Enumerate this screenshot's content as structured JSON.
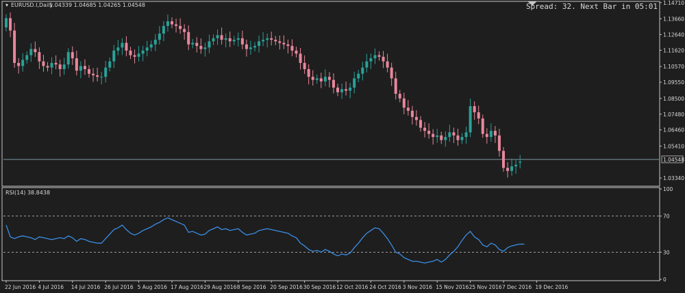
{
  "header": {
    "symbol": "EURUSD.I,Daily",
    "ohlc": "1.04339 1.04685 1.04265 1.04548",
    "spread_text": "Spread: 32. Next Bar in 05:01"
  },
  "colors": {
    "background": "#1e1e1e",
    "bull": "#2aa198",
    "bear": "#e8879c",
    "rsi_line": "#3a8ee6",
    "grid": "#c8c8c8",
    "current_price_line": "#7f9aa8"
  },
  "chart_data": [
    {
      "type": "candlestick",
      "title": "EURUSD.I,Daily",
      "ylim": [
        1.029,
        1.147
      ],
      "y_ticks": [
        "1.14710",
        "1.13660",
        "1.12640",
        "1.11620",
        "1.10570",
        "1.09550",
        "1.08500",
        "1.07480",
        "1.06460",
        "1.05410",
        "1.03340"
      ],
      "current_price": "1.04548",
      "x_labels": [
        "22 Jun 2016",
        "4 Jul 2016",
        "14 Jul 2016",
        "26 Jul 2016",
        "5 Aug 2016",
        "17 Aug 2016",
        "29 Aug 2016",
        "8 Sep 2016",
        "20 Sep 2016",
        "30 Sep 2016",
        "12 Oct 2016",
        "24 Oct 2016",
        "3 Nov 2016",
        "15 Nov 2016",
        "25 Nov 2016",
        "7 Dec 2016",
        "19 Dec 2016"
      ],
      "x_label_index": [
        0,
        8,
        16,
        24,
        32,
        40,
        48,
        56,
        64,
        72,
        80,
        88,
        96,
        104,
        112,
        120,
        128
      ],
      "close": [
        1.137,
        1.129,
        1.108,
        1.106,
        1.11,
        1.113,
        1.117,
        1.115,
        1.109,
        1.106,
        1.105,
        1.108,
        1.107,
        1.104,
        1.107,
        1.115,
        1.111,
        1.103,
        1.106,
        1.104,
        1.101,
        1.1,
        1.099,
        1.099,
        1.105,
        1.109,
        1.116,
        1.118,
        1.121,
        1.116,
        1.113,
        1.112,
        1.114,
        1.116,
        1.118,
        1.12,
        1.123,
        1.127,
        1.132,
        1.135,
        1.133,
        1.132,
        1.13,
        1.128,
        1.12,
        1.121,
        1.119,
        1.117,
        1.118,
        1.122,
        1.124,
        1.126,
        1.123,
        1.124,
        1.122,
        1.123,
        1.124,
        1.12,
        1.117,
        1.118,
        1.119,
        1.122,
        1.123,
        1.124,
        1.123,
        1.122,
        1.121,
        1.12,
        1.119,
        1.116,
        1.114,
        1.108,
        1.104,
        1.099,
        1.097,
        1.098,
        1.096,
        1.099,
        1.097,
        1.092,
        1.089,
        1.091,
        1.09,
        1.092,
        1.098,
        1.101,
        1.105,
        1.109,
        1.111,
        1.113,
        1.112,
        1.109,
        1.105,
        1.098,
        1.088,
        1.085,
        1.079,
        1.077,
        1.073,
        1.071,
        1.066,
        1.064,
        1.062,
        1.06,
        1.061,
        1.058,
        1.06,
        1.063,
        1.061,
        1.058,
        1.06,
        1.063,
        1.08,
        1.076,
        1.072,
        1.062,
        1.06,
        1.064,
        1.061,
        1.051,
        1.04,
        1.038,
        1.041,
        1.042,
        1.044,
        1.0455
      ],
      "open": [
        1.131,
        1.137,
        1.129,
        1.108,
        1.106,
        1.11,
        1.113,
        1.117,
        1.115,
        1.109,
        1.106,
        1.105,
        1.108,
        1.107,
        1.104,
        1.107,
        1.115,
        1.111,
        1.103,
        1.106,
        1.104,
        1.101,
        1.1,
        1.099,
        1.099,
        1.105,
        1.109,
        1.116,
        1.118,
        1.121,
        1.116,
        1.113,
        1.112,
        1.114,
        1.116,
        1.118,
        1.12,
        1.123,
        1.127,
        1.132,
        1.135,
        1.133,
        1.132,
        1.13,
        1.128,
        1.12,
        1.121,
        1.119,
        1.117,
        1.118,
        1.122,
        1.124,
        1.126,
        1.123,
        1.124,
        1.122,
        1.123,
        1.124,
        1.12,
        1.117,
        1.118,
        1.119,
        1.122,
        1.123,
        1.124,
        1.123,
        1.122,
        1.121,
        1.12,
        1.119,
        1.116,
        1.114,
        1.108,
        1.104,
        1.099,
        1.097,
        1.098,
        1.096,
        1.099,
        1.097,
        1.092,
        1.089,
        1.091,
        1.09,
        1.092,
        1.098,
        1.101,
        1.105,
        1.109,
        1.111,
        1.113,
        1.112,
        1.109,
        1.105,
        1.098,
        1.088,
        1.085,
        1.079,
        1.077,
        1.073,
        1.071,
        1.066,
        1.064,
        1.062,
        1.06,
        1.061,
        1.058,
        1.06,
        1.063,
        1.061,
        1.058,
        1.06,
        1.063,
        1.08,
        1.076,
        1.072,
        1.062,
        1.06,
        1.064,
        1.061,
        1.051,
        1.04,
        1.038,
        1.041,
        1.0434
      ]
    },
    {
      "type": "line",
      "title": "RSI(14) 38.8438",
      "ylim": [
        0,
        100
      ],
      "y_ticks": [
        "100",
        "70",
        "30",
        "0"
      ],
      "levels": [
        70,
        30
      ],
      "series": [
        {
          "name": "RSI(14)",
          "values": [
            60,
            47,
            45,
            47,
            48,
            47,
            46,
            44,
            47,
            46,
            45,
            44,
            45,
            46,
            45,
            48,
            46,
            42,
            45,
            44,
            42,
            41,
            40,
            40,
            45,
            50,
            55,
            57,
            60,
            55,
            51,
            49,
            51,
            54,
            56,
            58,
            61,
            63,
            66,
            68,
            66,
            64,
            62,
            60,
            52,
            53,
            51,
            49,
            50,
            54,
            56,
            58,
            55,
            56,
            54,
            55,
            56,
            52,
            49,
            50,
            51,
            54,
            55,
            56,
            55,
            54,
            53,
            52,
            51,
            48,
            46,
            40,
            37,
            33,
            31,
            32,
            30,
            33,
            31,
            28,
            26,
            28,
            27,
            29,
            35,
            40,
            46,
            51,
            54,
            57,
            56,
            51,
            45,
            38,
            30,
            28,
            24,
            22,
            20,
            20,
            19,
            18,
            19,
            20,
            22,
            19,
            22,
            27,
            31,
            36,
            43,
            49,
            53,
            47,
            44,
            38,
            36,
            40,
            38,
            33,
            31,
            35,
            37,
            38,
            39,
            38.84
          ]
        }
      ]
    }
  ]
}
